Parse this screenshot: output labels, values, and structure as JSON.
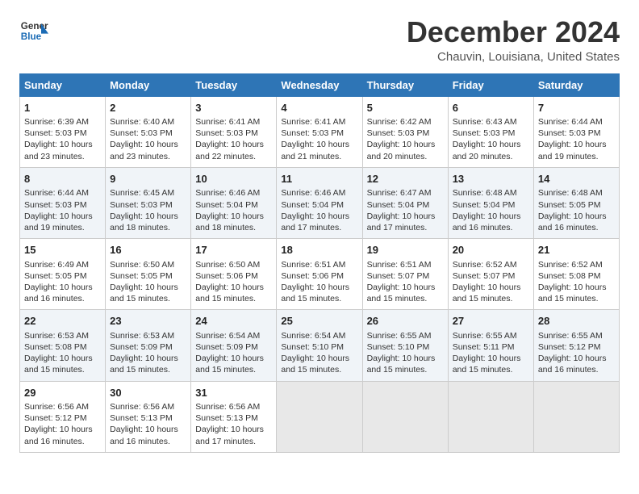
{
  "header": {
    "logo_line1": "General",
    "logo_line2": "Blue",
    "title": "December 2024",
    "subtitle": "Chauvin, Louisiana, United States"
  },
  "days_of_week": [
    "Sunday",
    "Monday",
    "Tuesday",
    "Wednesday",
    "Thursday",
    "Friday",
    "Saturday"
  ],
  "weeks": [
    [
      {
        "day": "1",
        "lines": [
          "Sunrise: 6:39 AM",
          "Sunset: 5:03 PM",
          "Daylight: 10 hours",
          "and 23 minutes."
        ]
      },
      {
        "day": "2",
        "lines": [
          "Sunrise: 6:40 AM",
          "Sunset: 5:03 PM",
          "Daylight: 10 hours",
          "and 23 minutes."
        ]
      },
      {
        "day": "3",
        "lines": [
          "Sunrise: 6:41 AM",
          "Sunset: 5:03 PM",
          "Daylight: 10 hours",
          "and 22 minutes."
        ]
      },
      {
        "day": "4",
        "lines": [
          "Sunrise: 6:41 AM",
          "Sunset: 5:03 PM",
          "Daylight: 10 hours",
          "and 21 minutes."
        ]
      },
      {
        "day": "5",
        "lines": [
          "Sunrise: 6:42 AM",
          "Sunset: 5:03 PM",
          "Daylight: 10 hours",
          "and 20 minutes."
        ]
      },
      {
        "day": "6",
        "lines": [
          "Sunrise: 6:43 AM",
          "Sunset: 5:03 PM",
          "Daylight: 10 hours",
          "and 20 minutes."
        ]
      },
      {
        "day": "7",
        "lines": [
          "Sunrise: 6:44 AM",
          "Sunset: 5:03 PM",
          "Daylight: 10 hours",
          "and 19 minutes."
        ]
      }
    ],
    [
      {
        "day": "8",
        "lines": [
          "Sunrise: 6:44 AM",
          "Sunset: 5:03 PM",
          "Daylight: 10 hours",
          "and 19 minutes."
        ]
      },
      {
        "day": "9",
        "lines": [
          "Sunrise: 6:45 AM",
          "Sunset: 5:03 PM",
          "Daylight: 10 hours",
          "and 18 minutes."
        ]
      },
      {
        "day": "10",
        "lines": [
          "Sunrise: 6:46 AM",
          "Sunset: 5:04 PM",
          "Daylight: 10 hours",
          "and 18 minutes."
        ]
      },
      {
        "day": "11",
        "lines": [
          "Sunrise: 6:46 AM",
          "Sunset: 5:04 PM",
          "Daylight: 10 hours",
          "and 17 minutes."
        ]
      },
      {
        "day": "12",
        "lines": [
          "Sunrise: 6:47 AM",
          "Sunset: 5:04 PM",
          "Daylight: 10 hours",
          "and 17 minutes."
        ]
      },
      {
        "day": "13",
        "lines": [
          "Sunrise: 6:48 AM",
          "Sunset: 5:04 PM",
          "Daylight: 10 hours",
          "and 16 minutes."
        ]
      },
      {
        "day": "14",
        "lines": [
          "Sunrise: 6:48 AM",
          "Sunset: 5:05 PM",
          "Daylight: 10 hours",
          "and 16 minutes."
        ]
      }
    ],
    [
      {
        "day": "15",
        "lines": [
          "Sunrise: 6:49 AM",
          "Sunset: 5:05 PM",
          "Daylight: 10 hours",
          "and 16 minutes."
        ]
      },
      {
        "day": "16",
        "lines": [
          "Sunrise: 6:50 AM",
          "Sunset: 5:05 PM",
          "Daylight: 10 hours",
          "and 15 minutes."
        ]
      },
      {
        "day": "17",
        "lines": [
          "Sunrise: 6:50 AM",
          "Sunset: 5:06 PM",
          "Daylight: 10 hours",
          "and 15 minutes."
        ]
      },
      {
        "day": "18",
        "lines": [
          "Sunrise: 6:51 AM",
          "Sunset: 5:06 PM",
          "Daylight: 10 hours",
          "and 15 minutes."
        ]
      },
      {
        "day": "19",
        "lines": [
          "Sunrise: 6:51 AM",
          "Sunset: 5:07 PM",
          "Daylight: 10 hours",
          "and 15 minutes."
        ]
      },
      {
        "day": "20",
        "lines": [
          "Sunrise: 6:52 AM",
          "Sunset: 5:07 PM",
          "Daylight: 10 hours",
          "and 15 minutes."
        ]
      },
      {
        "day": "21",
        "lines": [
          "Sunrise: 6:52 AM",
          "Sunset: 5:08 PM",
          "Daylight: 10 hours",
          "and 15 minutes."
        ]
      }
    ],
    [
      {
        "day": "22",
        "lines": [
          "Sunrise: 6:53 AM",
          "Sunset: 5:08 PM",
          "Daylight: 10 hours",
          "and 15 minutes."
        ]
      },
      {
        "day": "23",
        "lines": [
          "Sunrise: 6:53 AM",
          "Sunset: 5:09 PM",
          "Daylight: 10 hours",
          "and 15 minutes."
        ]
      },
      {
        "day": "24",
        "lines": [
          "Sunrise: 6:54 AM",
          "Sunset: 5:09 PM",
          "Daylight: 10 hours",
          "and 15 minutes."
        ]
      },
      {
        "day": "25",
        "lines": [
          "Sunrise: 6:54 AM",
          "Sunset: 5:10 PM",
          "Daylight: 10 hours",
          "and 15 minutes."
        ]
      },
      {
        "day": "26",
        "lines": [
          "Sunrise: 6:55 AM",
          "Sunset: 5:10 PM",
          "Daylight: 10 hours",
          "and 15 minutes."
        ]
      },
      {
        "day": "27",
        "lines": [
          "Sunrise: 6:55 AM",
          "Sunset: 5:11 PM",
          "Daylight: 10 hours",
          "and 15 minutes."
        ]
      },
      {
        "day": "28",
        "lines": [
          "Sunrise: 6:55 AM",
          "Sunset: 5:12 PM",
          "Daylight: 10 hours",
          "and 16 minutes."
        ]
      }
    ],
    [
      {
        "day": "29",
        "lines": [
          "Sunrise: 6:56 AM",
          "Sunset: 5:12 PM",
          "Daylight: 10 hours",
          "and 16 minutes."
        ]
      },
      {
        "day": "30",
        "lines": [
          "Sunrise: 6:56 AM",
          "Sunset: 5:13 PM",
          "Daylight: 10 hours",
          "and 16 minutes."
        ]
      },
      {
        "day": "31",
        "lines": [
          "Sunrise: 6:56 AM",
          "Sunset: 5:13 PM",
          "Daylight: 10 hours",
          "and 17 minutes."
        ]
      },
      null,
      null,
      null,
      null
    ]
  ]
}
